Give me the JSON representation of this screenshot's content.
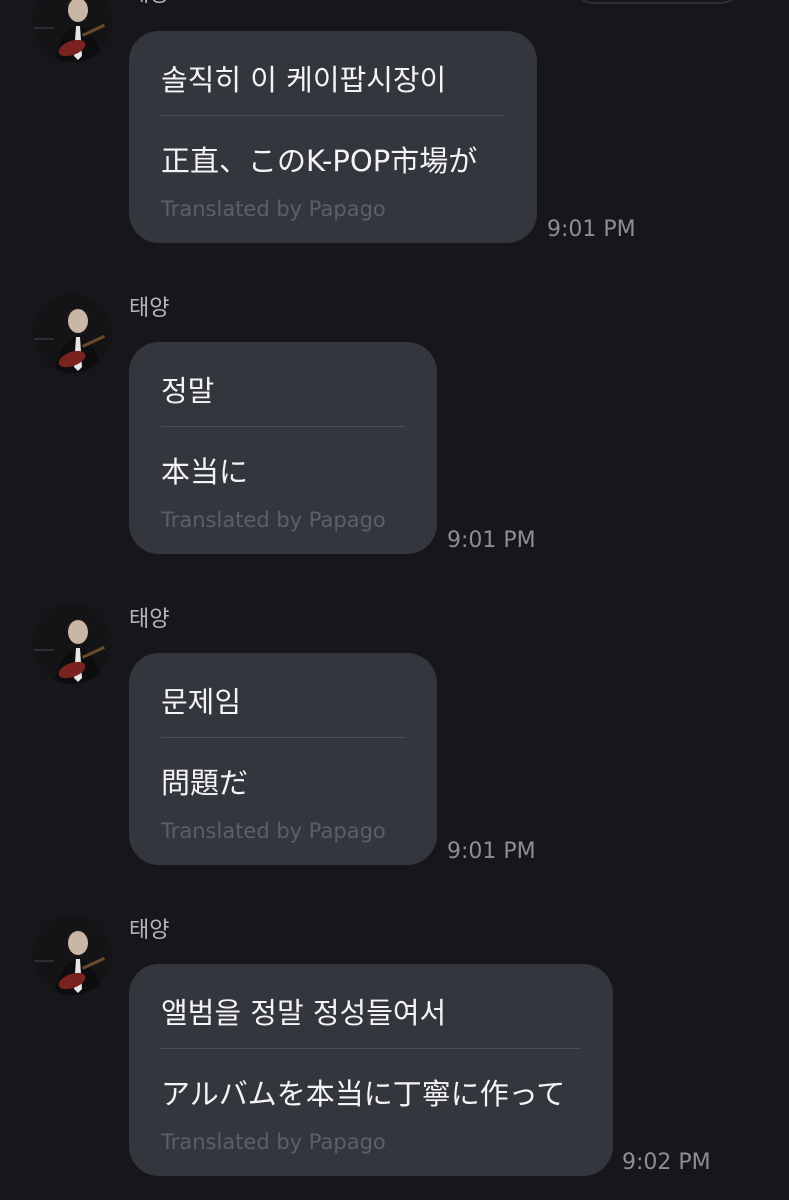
{
  "colors": {
    "background": "#17171b",
    "bubble": "#34363d",
    "divider": "#4c4e56",
    "credit_text": "#5d5f67",
    "timestamp_text": "#8d8d94",
    "sender_text": "#b5b5bb"
  },
  "messages": [
    {
      "sender": "태양",
      "original": "솔직히 이 케이팝시장이",
      "translation": "正直、このK-POP市場が",
      "credit": "Translated by Papago",
      "time": "9:01 PM"
    },
    {
      "sender": "태양",
      "original": "정말",
      "translation": "本当に",
      "credit": "Translated by Papago",
      "time": "9:01 PM"
    },
    {
      "sender": "태양",
      "original": "문제임",
      "translation": "問題だ",
      "credit": "Translated by Papago",
      "time": "9:01 PM"
    },
    {
      "sender": "태양",
      "original": "앨범을 정말 정성들여서",
      "translation": "アルバムを本当に丁寧に作って",
      "credit": "Translated by Papago",
      "time": "9:02 PM"
    }
  ]
}
